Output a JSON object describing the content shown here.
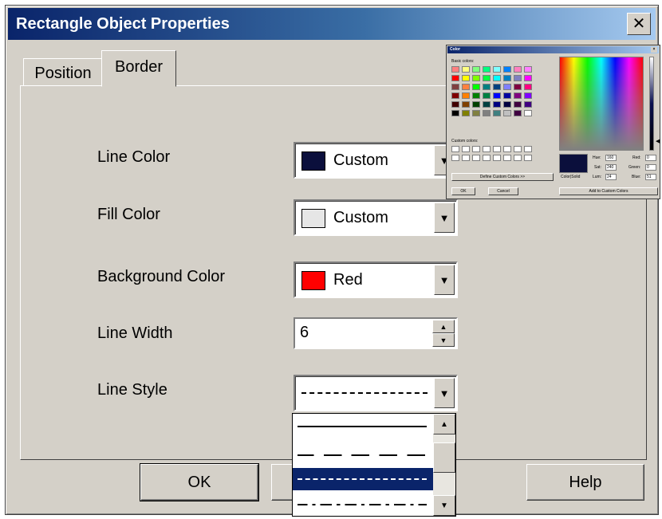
{
  "window": {
    "title": "Rectangle Object Properties",
    "close_glyph": "✕"
  },
  "tabs": [
    {
      "label": "Position",
      "active": false
    },
    {
      "label": "Border",
      "active": true
    }
  ],
  "fields": {
    "line_color": {
      "label": "Line Color",
      "value": "Custom",
      "swatch": "#0b0f3c"
    },
    "fill_color": {
      "label": "Fill Color",
      "value": "Custom",
      "swatch": "#e6e6e6"
    },
    "background_color": {
      "label": "Background Color",
      "value": "Red",
      "swatch": "#ff0000"
    },
    "line_width": {
      "label": "Line Width",
      "value": "6"
    },
    "line_style": {
      "label": "Line Style",
      "value": "dashed"
    }
  },
  "line_style_options": [
    {
      "style": "solid",
      "selected": false
    },
    {
      "style": "long-dash",
      "selected": false
    },
    {
      "style": "dashed",
      "selected": true
    },
    {
      "style": "dash-dot",
      "selected": false
    }
  ],
  "buttons": {
    "ok": "OK",
    "apply_partial": "ply",
    "help": "Help"
  },
  "color_dialog": {
    "title": "Color",
    "basic_colors_label": "Basic colors:",
    "custom_colors_label": "Custom colors:",
    "define_custom_button": "Define Custom Colors >>",
    "ok_button": "OK",
    "cancel_button": "Cancel",
    "add_custom_button": "Add to Custom Colors",
    "color_solid_label": "Color|Solid",
    "hue_label": "Hue:",
    "hue_value": "160",
    "sat_label": "Sat:",
    "sat_value": "240",
    "lum_label": "Lum:",
    "lum_value": "24",
    "red_label": "Red:",
    "red_value": "0",
    "green_label": "Green:",
    "green_value": "0",
    "blue_label": "Blue:",
    "blue_value": "51",
    "basic_colors": [
      "#ff8080",
      "#ffff80",
      "#80ff80",
      "#00ff80",
      "#80ffff",
      "#0080ff",
      "#ff80c0",
      "#ff80ff",
      "#ff0000",
      "#ffff00",
      "#80ff00",
      "#00ff40",
      "#00ffff",
      "#0080c0",
      "#8080c0",
      "#ff00ff",
      "#804040",
      "#ff8040",
      "#00ff00",
      "#008080",
      "#004080",
      "#8080ff",
      "#800040",
      "#ff0080",
      "#800000",
      "#ff8000",
      "#008000",
      "#008040",
      "#0000ff",
      "#0000a0",
      "#800080",
      "#8000ff",
      "#400000",
      "#804000",
      "#004000",
      "#004040",
      "#000080",
      "#000040",
      "#400040",
      "#400080",
      "#000000",
      "#808000",
      "#808040",
      "#808080",
      "#408080",
      "#c0c0c0",
      "#400040",
      "#ffffff"
    ]
  }
}
